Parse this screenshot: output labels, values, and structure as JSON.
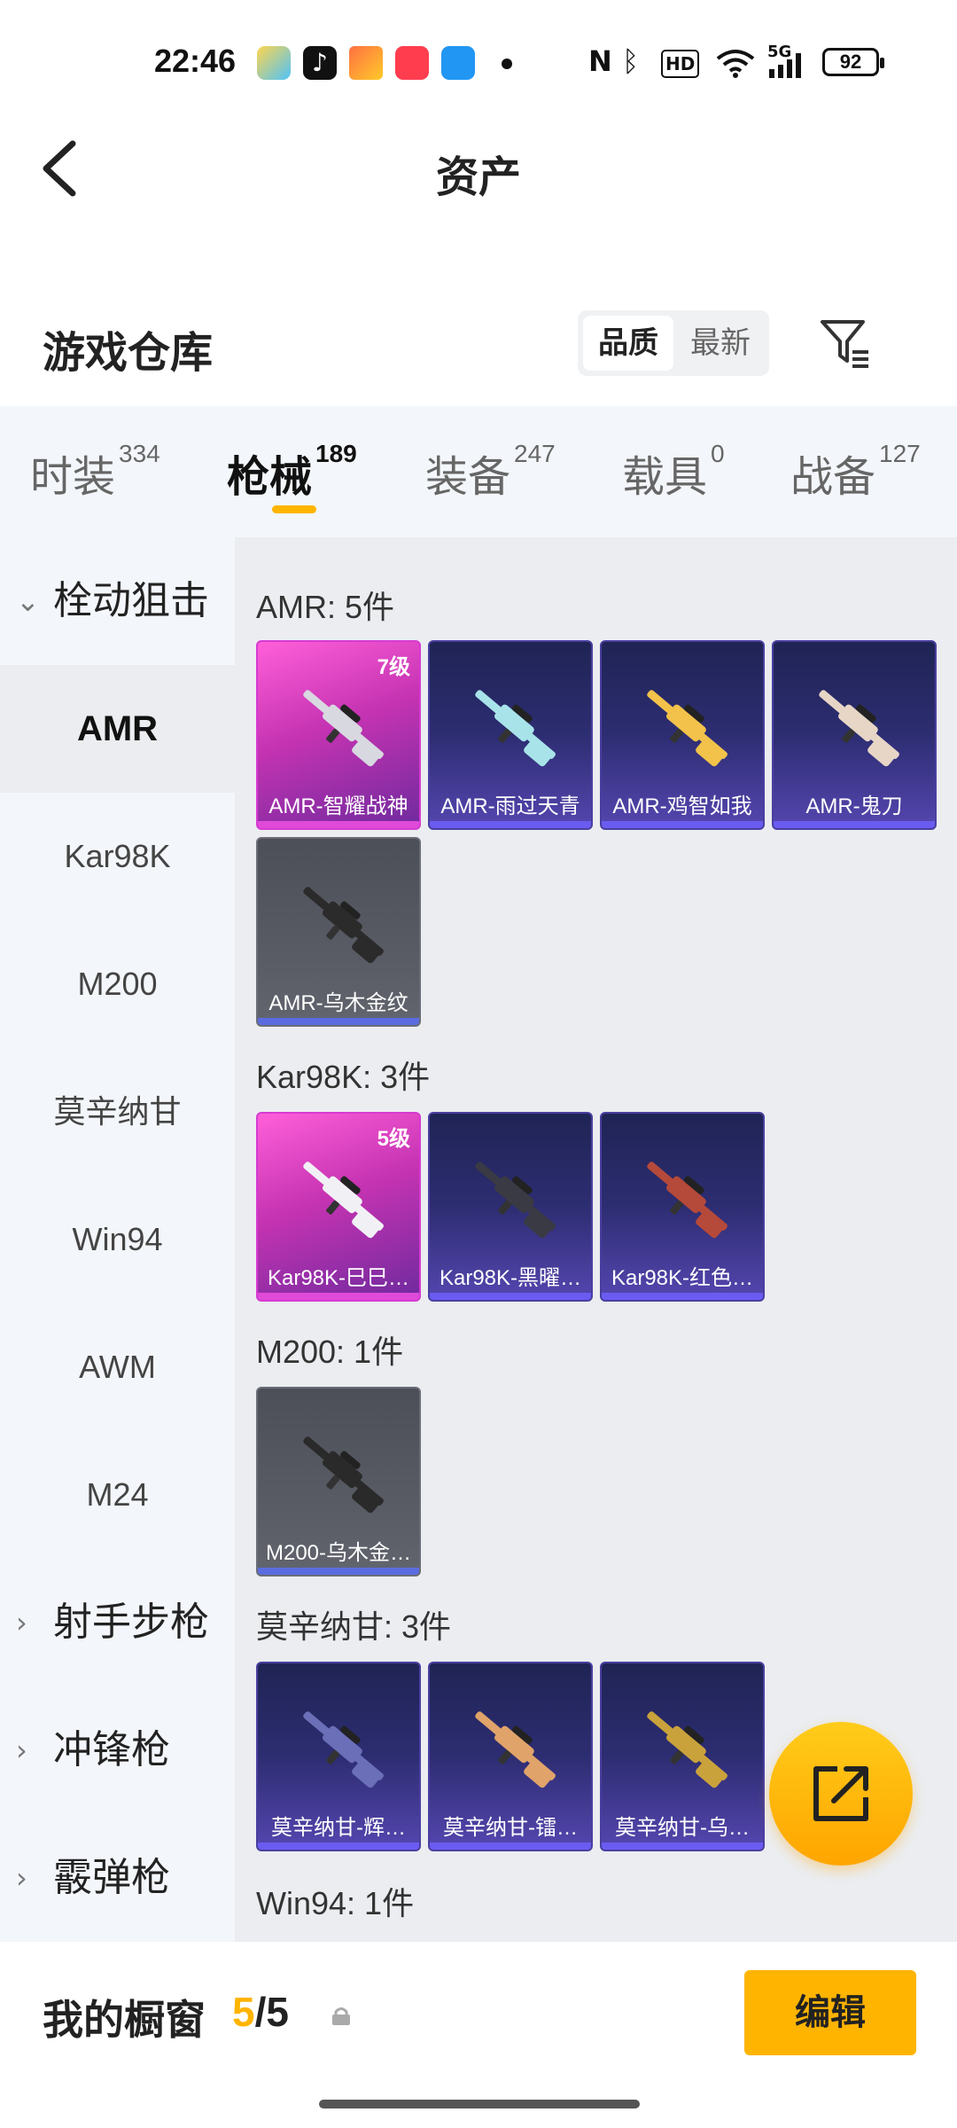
{
  "status": {
    "time": "22:46",
    "battery": "92",
    "network": "5G",
    "hd": "HD"
  },
  "header": {
    "title": "资产"
  },
  "warehouse": {
    "title": "游戏仓库",
    "sort_quality": "品质",
    "sort_newest": "最新"
  },
  "tabs": [
    {
      "label": "时装",
      "count": "334"
    },
    {
      "label": "枪械",
      "count": "189"
    },
    {
      "label": "装备",
      "count": "247"
    },
    {
      "label": "载具",
      "count": "0"
    },
    {
      "label": "战备",
      "count": "127"
    }
  ],
  "sidenav": {
    "group_bolt": "栓动狙击",
    "items": [
      "AMR",
      "Kar98K",
      "M200",
      "莫辛纳甘",
      "Win94",
      "AWM",
      "M24"
    ],
    "group_marksman": "射手步枪",
    "group_smg": "冲锋枪",
    "group_shotgun": "霰弹枪"
  },
  "sections": {
    "amr": {
      "title": "AMR: 5件",
      "cards": [
        {
          "name": "AMR-智耀战神",
          "level": "7级",
          "rarity": "pink",
          "color": "#d8d8e0"
        },
        {
          "name": "AMR-雨过天青",
          "level": "",
          "rarity": "purple",
          "color": "#a8e3ea"
        },
        {
          "name": "AMR-鸡智如我",
          "level": "",
          "rarity": "purple",
          "color": "#f2c24a"
        },
        {
          "name": "AMR-鬼刀",
          "level": "",
          "rarity": "purple",
          "color": "#e7d6c6"
        },
        {
          "name": "AMR-乌木金纹",
          "level": "",
          "rarity": "grey",
          "color": "#2b2b2b"
        }
      ]
    },
    "kar98k": {
      "title": "Kar98K: 3件",
      "cards": [
        {
          "name": "Kar98K-巳巳…",
          "level": "5级",
          "rarity": "pink",
          "color": "#f1f1f5"
        },
        {
          "name": "Kar98K-黑曜…",
          "level": "",
          "rarity": "purple",
          "color": "#3a3a44"
        },
        {
          "name": "Kar98K-红色…",
          "level": "",
          "rarity": "purple",
          "color": "#b5493a"
        }
      ]
    },
    "m200": {
      "title": "M200: 1件",
      "cards": [
        {
          "name": "M200-乌木金…",
          "level": "",
          "rarity": "grey",
          "color": "#2a2a2a"
        }
      ]
    },
    "mosin": {
      "title": "莫辛纳甘: 3件",
      "cards": [
        {
          "name": "莫辛纳甘-辉…",
          "level": "",
          "rarity": "purple",
          "color": "#6b6fb8"
        },
        {
          "name": "莫辛纳甘-镭…",
          "level": "",
          "rarity": "purple",
          "color": "#e0a36a"
        },
        {
          "name": "莫辛纳甘-乌…",
          "level": "",
          "rarity": "purple",
          "color": "#caa23c"
        }
      ]
    },
    "win94": {
      "title": "Win94: 1件"
    }
  },
  "showcase": {
    "label": "我的橱窗",
    "count_used": "5",
    "count_sep": "/",
    "count_total": "5",
    "edit_label": "编辑"
  },
  "colors": {
    "accent": "#ffb400",
    "rarity_pink": "#d63bd1",
    "rarity_purple": "#4a3fa0",
    "rarity_grey": "#6a6d77"
  }
}
